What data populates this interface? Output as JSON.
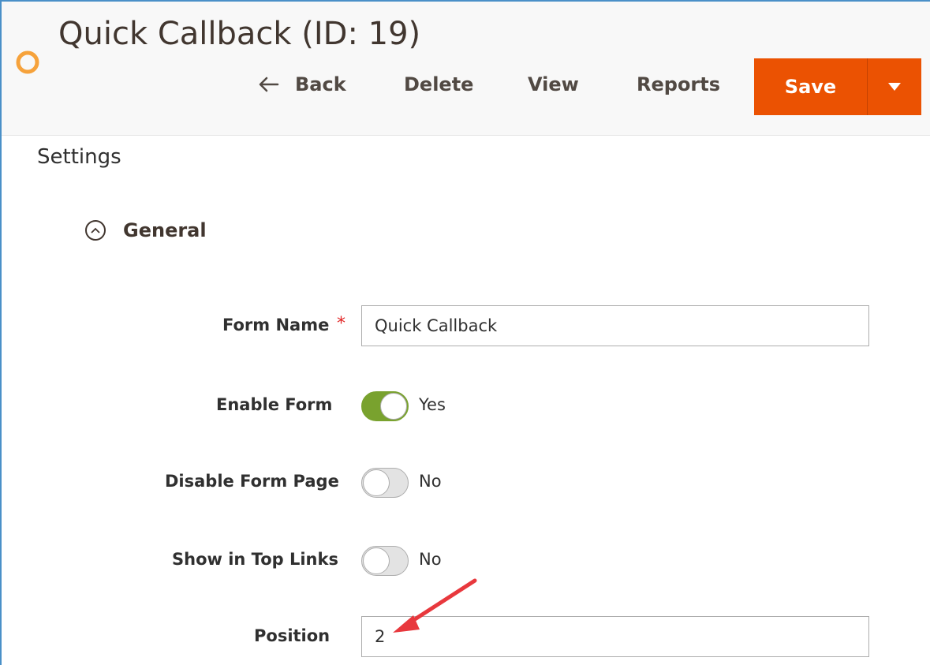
{
  "header": {
    "title": "Quick Callback (ID: 19)",
    "actions": {
      "back": "Back",
      "delete": "Delete",
      "view": "View",
      "reports": "Reports",
      "save": "Save"
    }
  },
  "settings": {
    "title": "Settings",
    "section": {
      "label": "General",
      "expanded": true
    },
    "fields": {
      "form_name": {
        "label": "Form Name",
        "required": "*",
        "value": "Quick Callback"
      },
      "enable_form": {
        "label": "Enable Form",
        "state": "Yes"
      },
      "disable_form_page": {
        "label": "Disable Form Page",
        "state": "No"
      },
      "show_in_top_links": {
        "label": "Show in Top Links",
        "state": "No"
      },
      "position": {
        "label": "Position",
        "value": "2"
      }
    }
  },
  "colors": {
    "accent": "#eb5202",
    "switch_on": "#79a22e",
    "annotation_arrow": "#e8383d",
    "logo": "#f6a23b"
  },
  "icons": {
    "logo": "logo-ring-icon",
    "back": "arrow-left-icon",
    "save_menu": "caret-down-icon",
    "section": "chevron-up-circle-icon",
    "annotation": "red-arrow-icon"
  }
}
